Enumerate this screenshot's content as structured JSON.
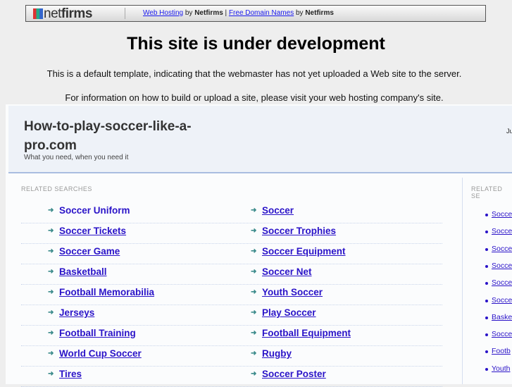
{
  "topbar": {
    "logo": "netfirms",
    "link1": "Web Hosting",
    "by1": " by ",
    "brand1": "Netfirms",
    "pipe": " | ",
    "link2": "Free Domain Names",
    "by2": " by ",
    "brand2": "Netfirms"
  },
  "title": "This site is under development",
  "line1": "This is a default template, indicating that the webmaster has not yet uploaded a Web site to the server.",
  "line2": "For information on how to build or upload a site, please visit your web hosting company's site.",
  "site": {
    "domain": "How-to-play-soccer-like-a-pro.com",
    "tagline": "What you need, when you need it",
    "date_fragment": "Ju"
  },
  "related_label": "RELATED SEARCHES",
  "side_label": "RELATED SE",
  "left_items": [
    "Soccer Uniform",
    "Soccer Tickets",
    "Soccer Game",
    "Basketball",
    "Football Memorabilia",
    "Jerseys",
    "Football Training",
    "World Cup Soccer",
    "Tires"
  ],
  "right_items": [
    "Soccer",
    "Soccer Trophies",
    "Soccer Equipment",
    "Soccer Net",
    "Youth Soccer",
    "Play Soccer",
    "Football Equipment",
    "Rugby",
    "Soccer Poster"
  ],
  "side_items": [
    "Socce",
    "Socce",
    "Socce",
    "Socce",
    "Socce",
    "Socce",
    "Baske",
    "Socce",
    "Footb",
    "Youth"
  ]
}
